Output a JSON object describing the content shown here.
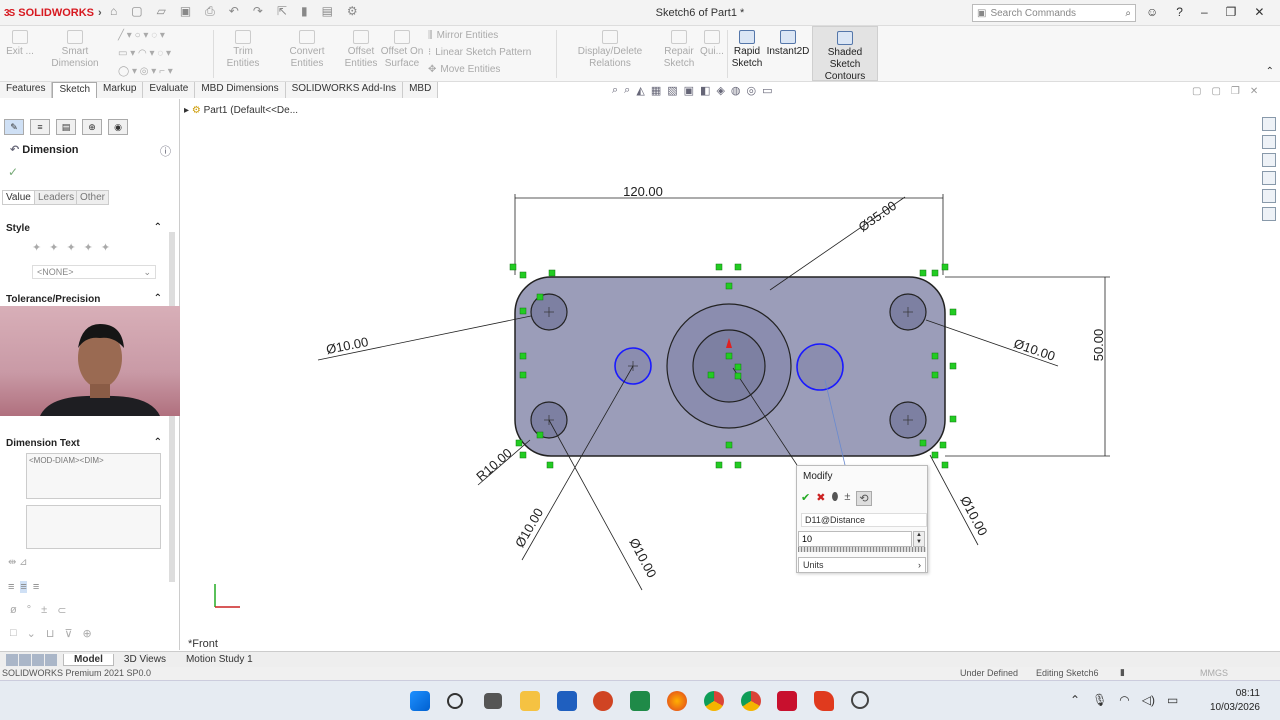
{
  "app": {
    "name": "SOLIDWORKS",
    "document_title": "Sketch6 of Part1 *"
  },
  "search": {
    "placeholder": "Search Commands"
  },
  "command_manager": {
    "exit": "Exit ...",
    "smart_dimension": "Smart Dimension",
    "trim": "Trim Entities",
    "convert": "Convert Entities",
    "offset": "Offset Entities",
    "offset_surface": "Offset On Surface",
    "mirror": "Mirror Entities",
    "linear_pattern": "Linear Sketch Pattern",
    "move": "Move Entities",
    "display_delete": "Display/Delete Relations",
    "repair": "Repair Sketch",
    "quick": "Qui...",
    "rapid": "Rapid Sketch",
    "instant2d": "Instant2D",
    "shaded": "Shaded Sketch Contours"
  },
  "tabs": [
    "Features",
    "Sketch",
    "Markup",
    "Evaluate",
    "MBD Dimensions",
    "SOLIDWORKS Add-Ins",
    "MBD"
  ],
  "active_tab": "Sketch",
  "tree": {
    "root": "Part1 (Default<<De..."
  },
  "property_manager": {
    "title": "Dimension",
    "subtabs": [
      "Value",
      "Leaders",
      "Other"
    ],
    "style_header": "Style",
    "style_value": "<NONE>",
    "tolerance_header": "Tolerance/Precision",
    "dimtext_header": "Dimension Text",
    "dimtext_value": "<MOD-DIAM><DIM>"
  },
  "drawing": {
    "dimensions": {
      "width": "120.00",
      "height": "50.00",
      "big_dia": "Ø35.00",
      "left_hole": "Ø10.00",
      "right_hole": "Ø10.00",
      "radius": "R10.00",
      "bl_hole_a": "Ø10.00",
      "bl_hole_b": "Ø10.00",
      "br_hole": "Ø10.00"
    },
    "view_label": "*Front"
  },
  "modify": {
    "title": "Modify",
    "dim_name": "D11@Distance",
    "value": "10",
    "units_label": "Units"
  },
  "bottom_tabs": [
    "Model",
    "3D Views",
    "Motion Study 1"
  ],
  "status": {
    "product": "SOLIDWORKS Premium 2021 SP0.0",
    "state": "Under Defined",
    "editing": "Editing Sketch6",
    "units": "MMGS"
  },
  "clock": {
    "time": "08:11",
    "date": "10/03/2026"
  },
  "colors": {
    "accent": "#d71920",
    "part_fill": "#9b9db9",
    "relation_green": "#22cc22",
    "selected_blue": "#1a1aff"
  }
}
